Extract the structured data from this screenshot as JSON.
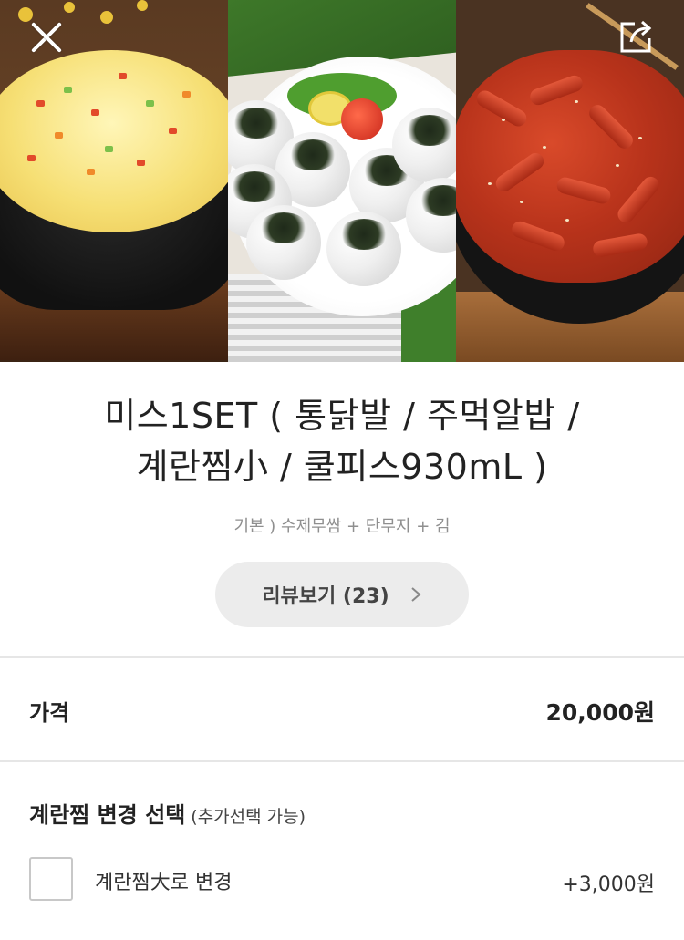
{
  "header": {
    "close_icon": "close-icon",
    "share_icon": "share-icon"
  },
  "hero": {
    "images": [
      "steamed-egg-photo",
      "rice-ball-photo",
      "spicy-chicken-feet-photo"
    ]
  },
  "product": {
    "title_line1": "미스1SET ( 통닭발 / 주먹알밥 /",
    "title_line2": "계란찜小 / 쿨피스930mL )",
    "subtitle": "기본 ) 수제무쌈 + 단무지 + 김"
  },
  "reviews": {
    "label": "리뷰보기 (23)",
    "icon": "chevron-right-icon"
  },
  "price": {
    "label": "가격",
    "value": "20,000원"
  },
  "options": {
    "title": "계란찜 변경 선택",
    "hint": "(추가선택 가능)",
    "items": [
      {
        "label": "계란찜大로 변경",
        "price": "+3,000원",
        "checked": false
      }
    ]
  },
  "colors": {
    "divider": "#e6e6e6",
    "review_bg": "#ececec",
    "subtitle": "#8f8f8f"
  }
}
